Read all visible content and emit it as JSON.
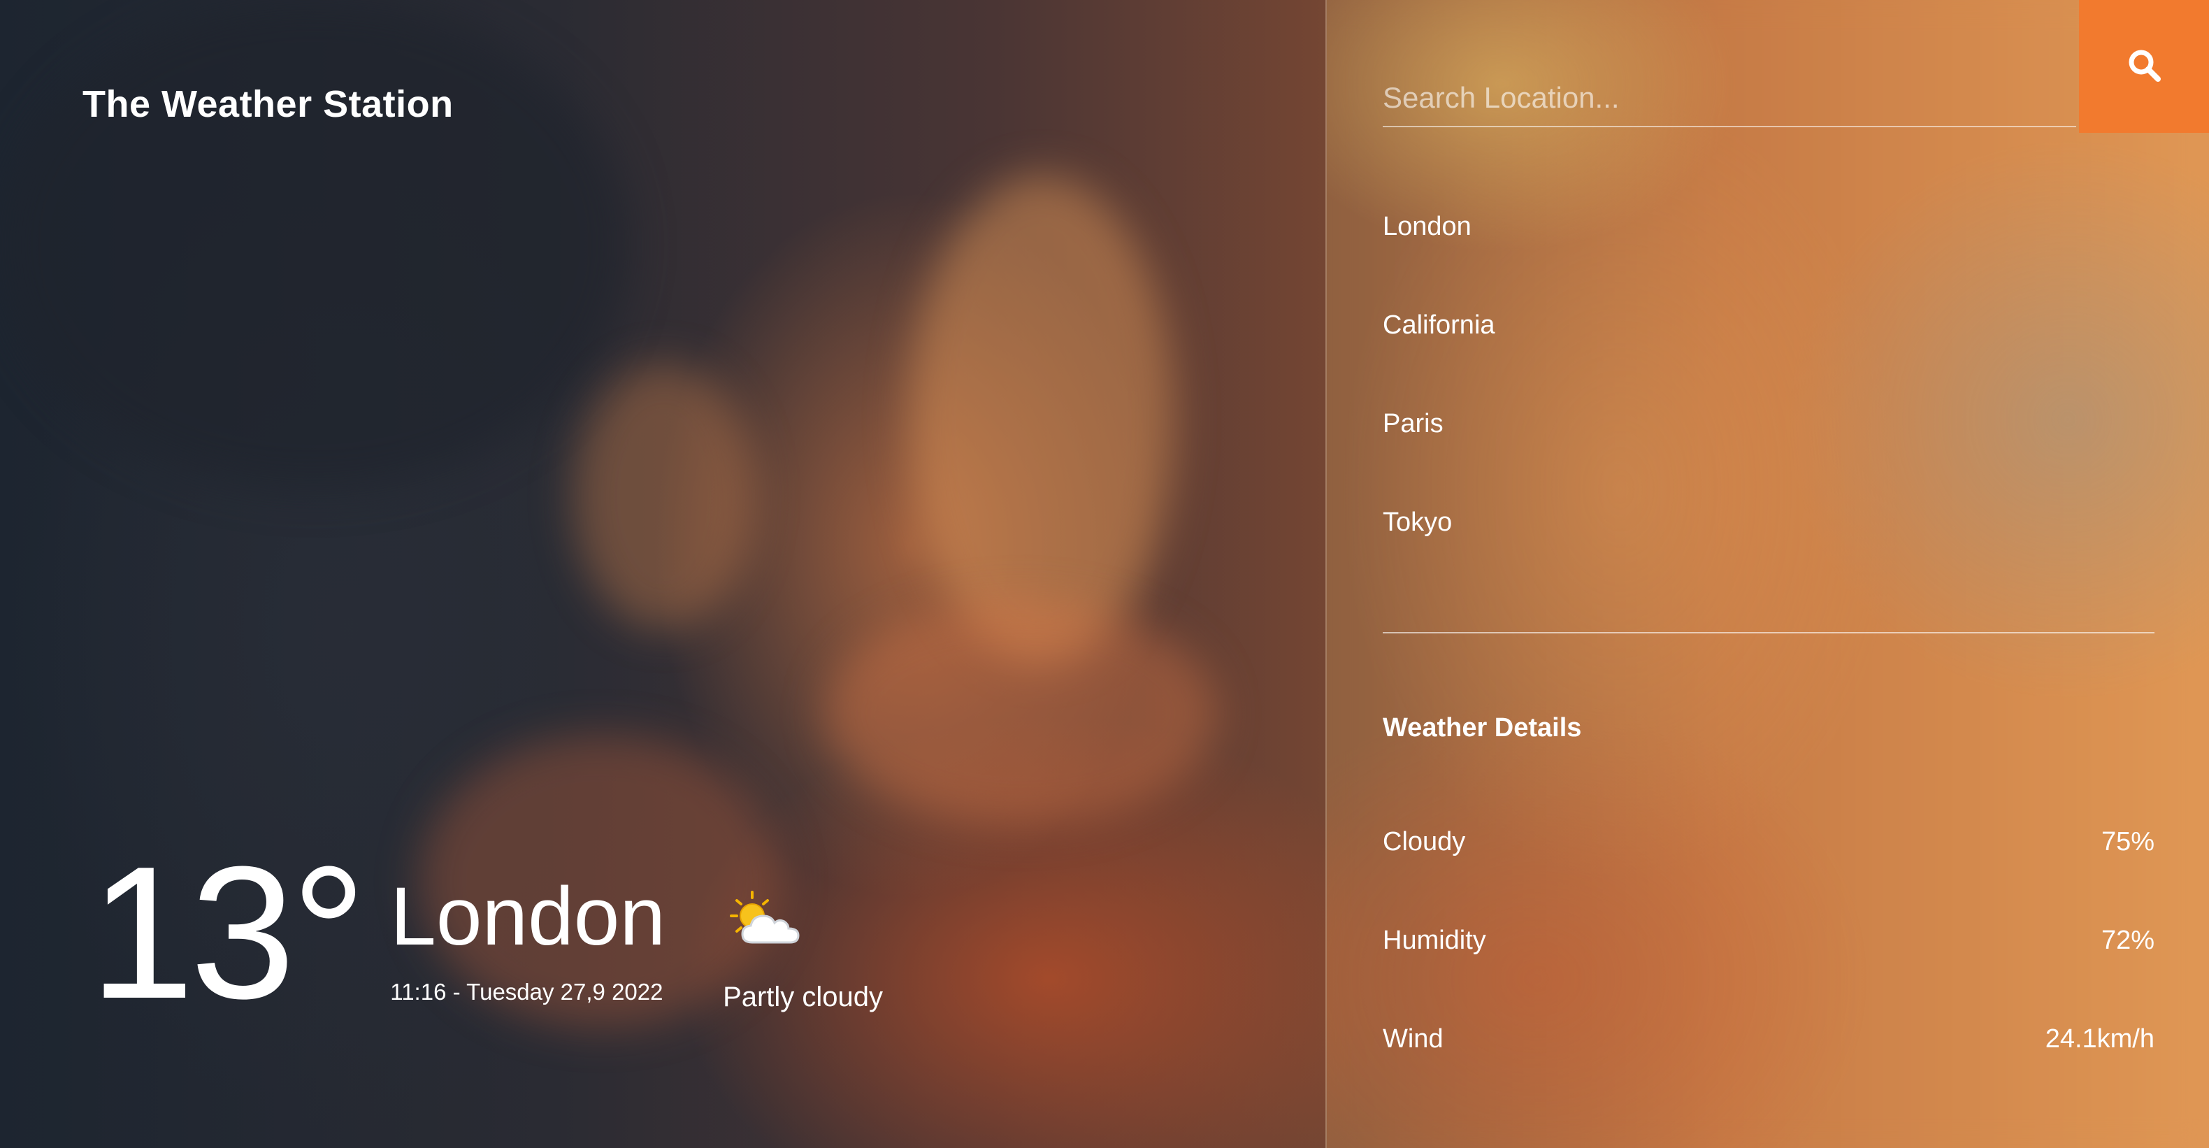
{
  "brand": {
    "title": "The Weather Station"
  },
  "current": {
    "temperature": "13°",
    "location": "London",
    "datetime": "11:16 - Tuesday 27,9 2022",
    "condition": "Partly cloudy",
    "condition_icon": "partly-cloudy-icon"
  },
  "search": {
    "placeholder": "Search Location...",
    "value": "",
    "button_icon": "search-icon"
  },
  "cities": [
    {
      "label": "London"
    },
    {
      "label": "California"
    },
    {
      "label": "Paris"
    },
    {
      "label": "Tokyo"
    }
  ],
  "details": {
    "title": "Weather Details",
    "rows": [
      {
        "label": "Cloudy",
        "value": "75%"
      },
      {
        "label": "Humidity",
        "value": "72%"
      },
      {
        "label": "Wind",
        "value": "24.1km/h"
      }
    ]
  },
  "colors": {
    "accent": "#f27a2e",
    "text": "#ffffff"
  }
}
